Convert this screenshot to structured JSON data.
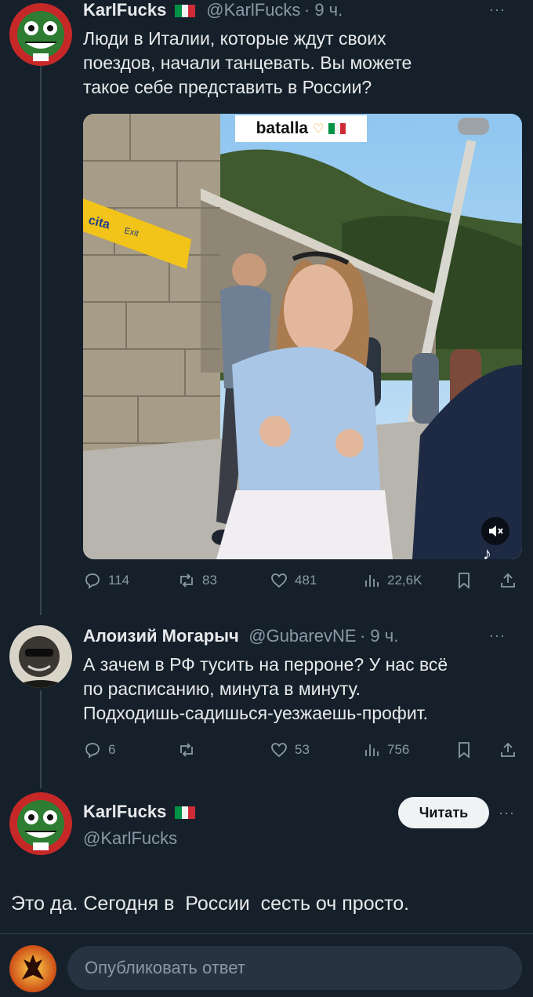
{
  "tweet1": {
    "name": "KarlFucks",
    "handle": "@KarlFucks",
    "time": "· 9 ч.",
    "text_lines": [
      "Люди в Италии, которые ждут своих",
      "поездов, начали танцевать. Вы можете",
      "такое себе представить в России?"
    ],
    "media": {
      "overlay_label": "batalla",
      "sign_text": "cita",
      "sign_exit": "Exit",
      "mute_icon": "mute-icon",
      "tiktok_icon": "tiktok-icon"
    },
    "stats": {
      "replies": "114",
      "reposts": "83",
      "likes": "481",
      "views": "22,6K"
    }
  },
  "tweet2": {
    "name": "Алоизий Могарыч",
    "handle": "@GubarevNE",
    "time": "· 9 ч.",
    "text_lines": [
      "А зачем в РФ тусить на перроне? У нас всё",
      "по расписанию, минута в минуту.",
      "Подходишь-садишься-уезжаешь-профит."
    ],
    "stats": {
      "replies": "6",
      "reposts": "",
      "likes": "53",
      "views": "756"
    }
  },
  "tweet3": {
    "name": "KarlFucks",
    "handle": "@KarlFucks",
    "follow_label": "Читать",
    "text": "Это да. Сегодня в  России  сесть оч просто."
  },
  "reply": {
    "placeholder": "Опубликовать ответ"
  },
  "colors": {
    "background": "#15202b",
    "text": "#e7e9ea",
    "muted": "#8b98a5",
    "flag_green": "#009246",
    "flag_white": "#f1f2f1",
    "flag_red": "#ce2b37"
  }
}
